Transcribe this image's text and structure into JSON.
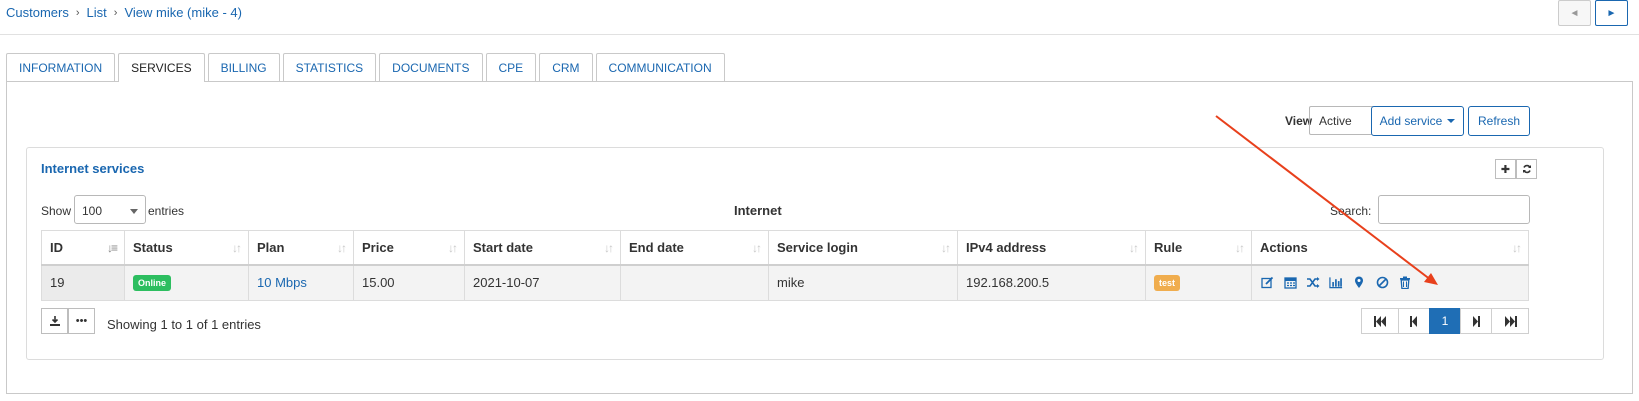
{
  "breadcrumb": {
    "items": [
      "Customers",
      "List",
      "View mike (mike - 4)"
    ]
  },
  "nav": {
    "prev": "◄",
    "next": "►"
  },
  "tabs": [
    "INFORMATION",
    "SERVICES",
    "BILLING",
    "STATISTICS",
    "DOCUMENTS",
    "CPE",
    "CRM",
    "COMMUNICATION"
  ],
  "active_tab": "SERVICES",
  "toolbar": {
    "view_label": "View",
    "view_value": "Active",
    "add_service": "Add service",
    "refresh": "Refresh"
  },
  "card": {
    "title": "Internet services",
    "show_label": "Show",
    "page_length": "100",
    "entries_label": "entries",
    "caption": "Internet",
    "search_label": "Search:",
    "search_value": ""
  },
  "table": {
    "columns": [
      "ID",
      "Status",
      "Plan",
      "Price",
      "Start date",
      "End date",
      "Service login",
      "IPv4 address",
      "Rule",
      "Actions"
    ],
    "rows": [
      {
        "id": "19",
        "status": "Online",
        "plan": "10 Mbps",
        "price": "15.00",
        "start_date": "2021-10-07",
        "end_date": "",
        "service_login": "mike",
        "ipv4": "192.168.200.5",
        "rule": "test"
      }
    ]
  },
  "footer": {
    "info": "Showing 1 to 1 of 1 entries",
    "current_page": "1"
  },
  "colors": {
    "link": "#1a67b0",
    "online": "#2dbe60",
    "test": "#f0ad4e",
    "annotation_arrow": "#e8401c",
    "page_active": "#1f6eb5"
  },
  "icons": [
    "edit-icon",
    "calendar-icon",
    "shuffle-icon",
    "bar-chart-icon",
    "map-marker-icon",
    "block-icon",
    "trash-icon"
  ]
}
